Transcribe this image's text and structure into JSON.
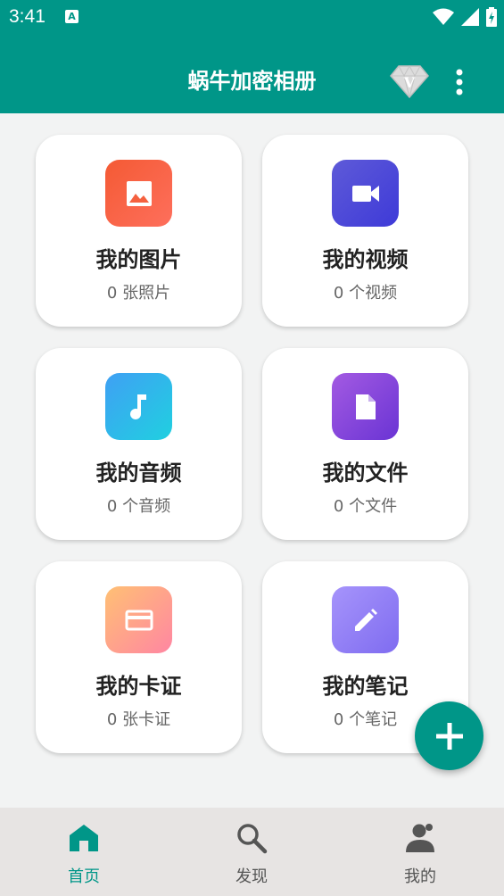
{
  "status_bar": {
    "time": "3:41",
    "notif_letter": "A"
  },
  "app_bar": {
    "title": "蜗牛加密相册",
    "vip_letter": "V"
  },
  "cards": [
    {
      "title": "我的图片",
      "subtitle": "0 张照片",
      "icon": "image-icon",
      "gradient": [
        "#f45a34",
        "#fe6f5c"
      ]
    },
    {
      "title": "我的视频",
      "subtitle": "0 个视频",
      "icon": "videocam-icon",
      "gradient": [
        "#5e5ad8",
        "#3e3ad8"
      ]
    },
    {
      "title": "我的音频",
      "subtitle": "0 个音频",
      "icon": "music-note-icon",
      "gradient": [
        "#3fa0f4",
        "#20d0e0"
      ]
    },
    {
      "title": "我的文件",
      "subtitle": "0 个文件",
      "icon": "file-icon",
      "gradient": [
        "#a35ae2",
        "#6a34d4"
      ]
    },
    {
      "title": "我的卡证",
      "subtitle": "0 张卡证",
      "icon": "card-icon",
      "gradient": [
        "#ffc074",
        "#ff86a2"
      ]
    },
    {
      "title": "我的笔记",
      "subtitle": "0 个笔记",
      "icon": "edit-icon",
      "gradient": [
        "#a694fb",
        "#7f6cf0"
      ]
    }
  ],
  "bottom_nav": [
    {
      "label": "首页",
      "icon": "home-icon",
      "active": true
    },
    {
      "label": "发现",
      "icon": "search-icon",
      "active": false
    },
    {
      "label": "我的",
      "icon": "person-icon",
      "active": false
    }
  ],
  "colors": {
    "primary": "#009688",
    "background": "#f2f3f3",
    "nav_background": "#e7e4e3"
  }
}
